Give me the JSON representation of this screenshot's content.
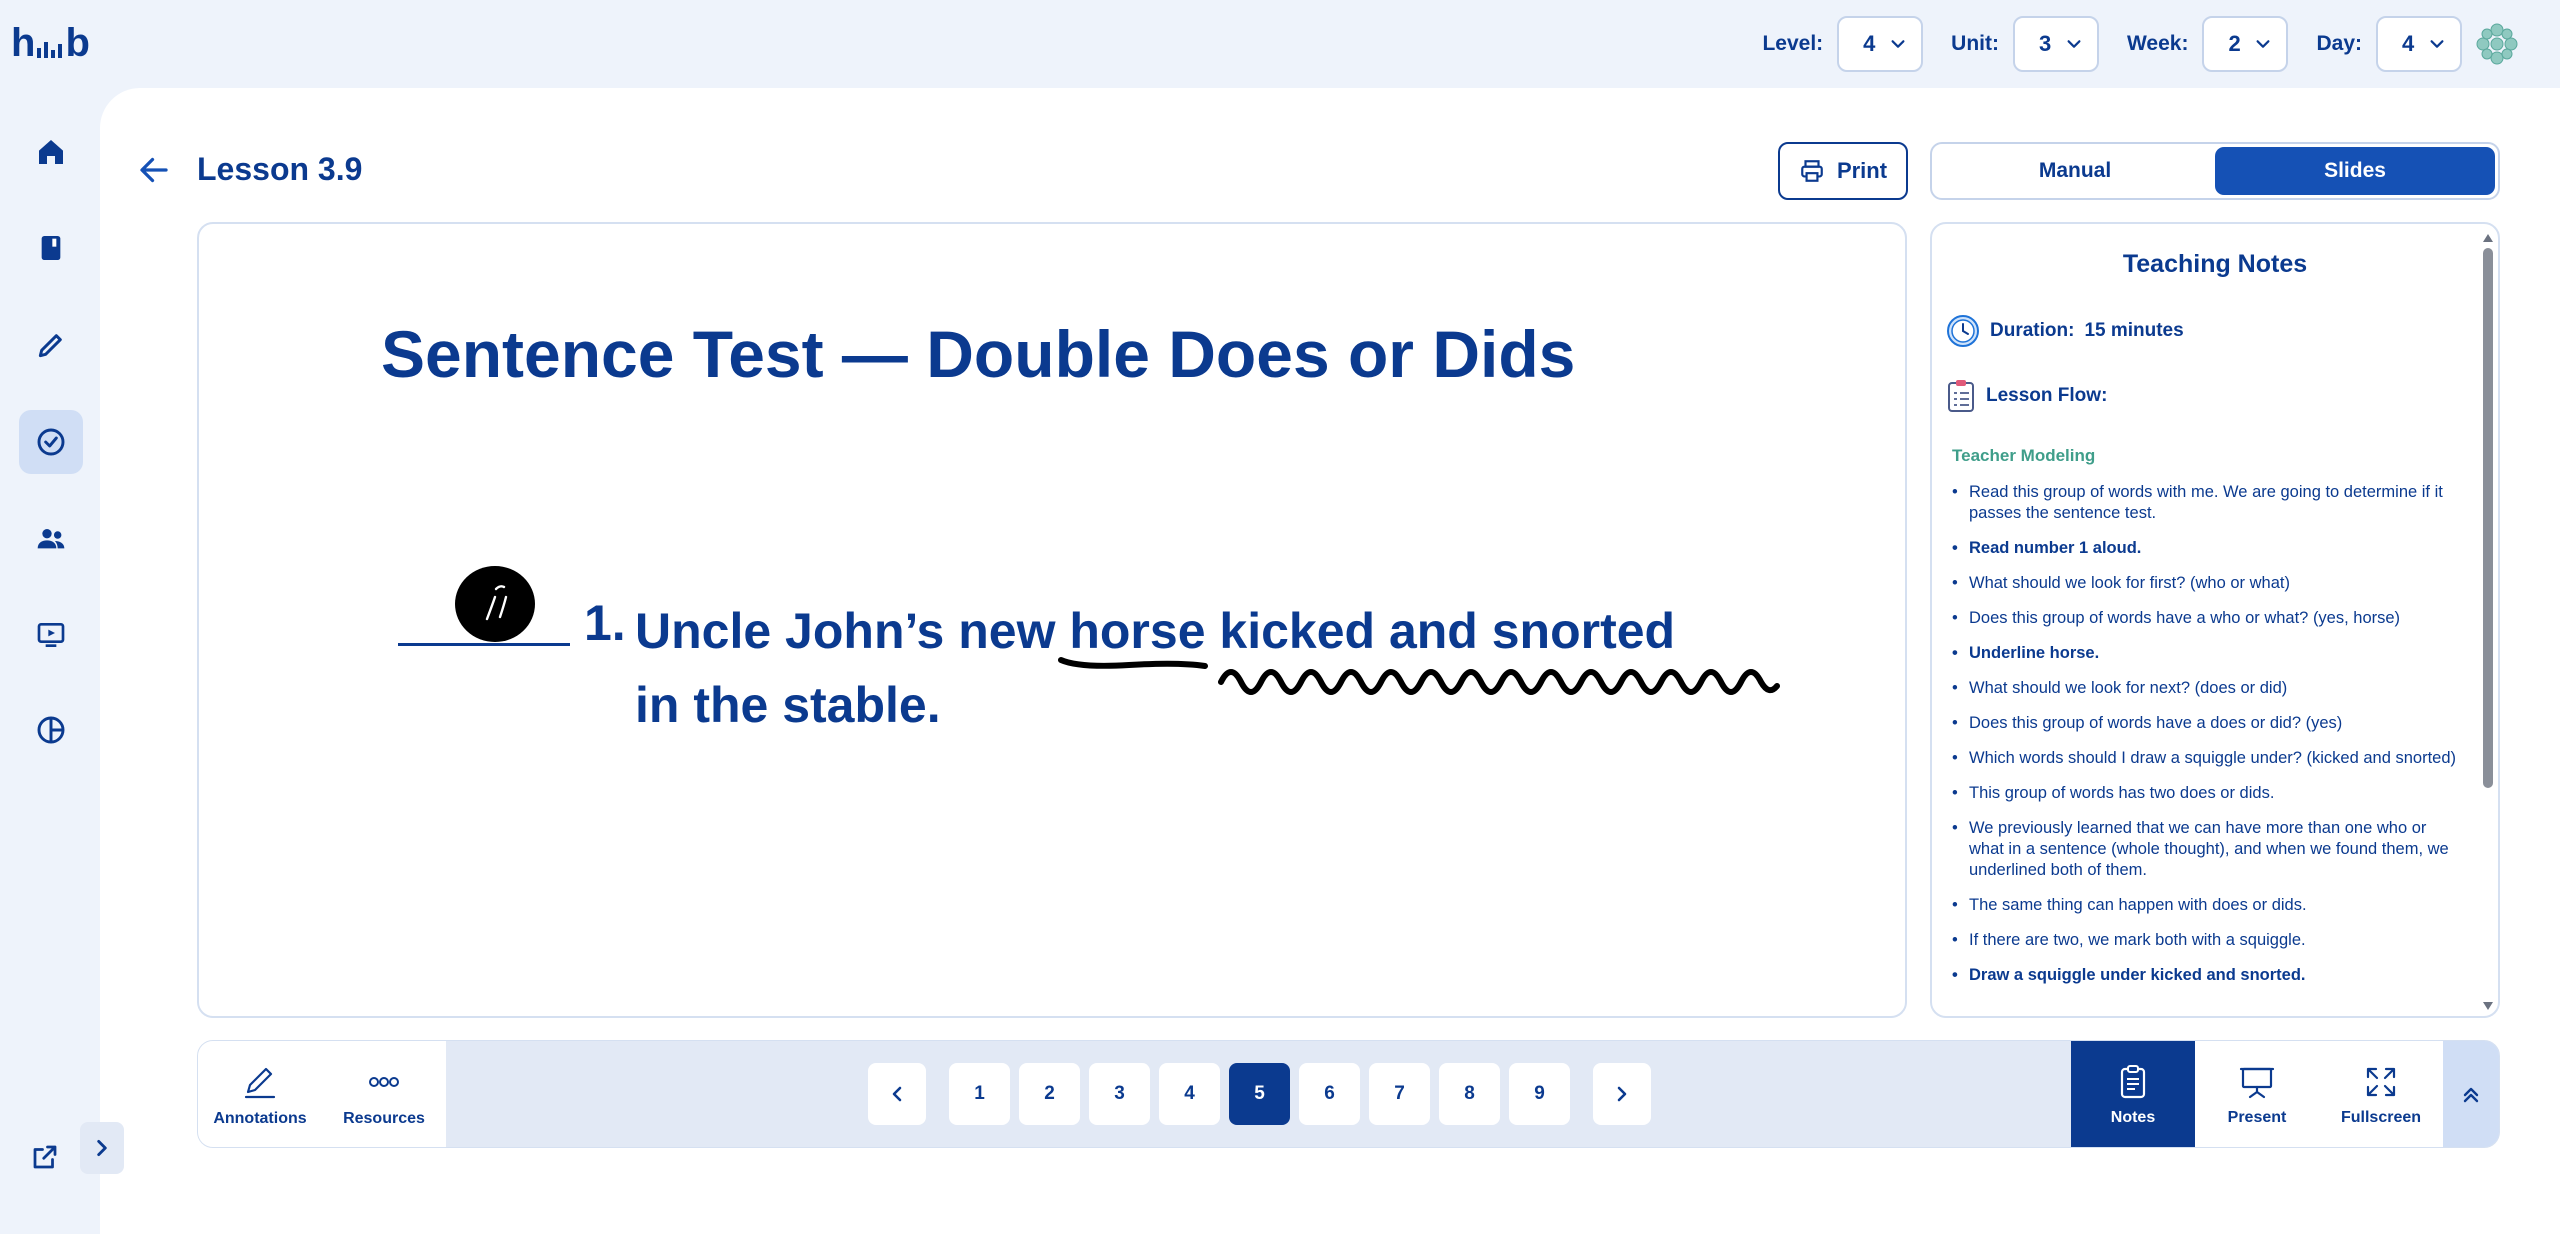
{
  "app": {
    "logo": "hub"
  },
  "topbar": {
    "selectors": [
      {
        "label": "Level:",
        "value": "4"
      },
      {
        "label": "Unit:",
        "value": "3"
      },
      {
        "label": "Week:",
        "value": "2"
      },
      {
        "label": "Day:",
        "value": "4"
      }
    ]
  },
  "sidebar": {
    "items": [
      {
        "icon": "home-icon",
        "active": false
      },
      {
        "icon": "book-icon",
        "active": false
      },
      {
        "icon": "pencil-icon",
        "active": false
      },
      {
        "icon": "check-circle-icon",
        "active": true
      },
      {
        "icon": "users-icon",
        "active": false
      },
      {
        "icon": "presentation-icon",
        "active": false
      },
      {
        "icon": "pie-chart-icon",
        "active": false
      }
    ]
  },
  "header": {
    "title": "Lesson 3.9",
    "print_label": "Print",
    "view_toggle": {
      "manual": "Manual",
      "slides": "Slides",
      "selected": "Slides"
    }
  },
  "slide": {
    "title": "Sentence Test — Double Does or Dids",
    "question_number": "1.",
    "line1": "Uncle John’s new horse kicked and snorted",
    "line2": "in the stable."
  },
  "notes": {
    "title": "Teaching Notes",
    "duration_label": "Duration:",
    "duration_value": "15 minutes",
    "flow_label": "Lesson Flow:",
    "section": "Teacher Modeling",
    "items": [
      "Read this group of words with me. We are going to determine if it passes the sentence test.",
      "Read number 1 aloud.",
      "What should we look for first? (who or what)",
      "Does this group of words have a who or what? (yes, horse)",
      "Underline horse.",
      "What should we look for next? (does or did)",
      "Does this group of words have a does or did? (yes)",
      "Which words should I draw a squiggle under? (kicked and snorted)",
      "This group of words has two does or dids.",
      "We previously learned that we can have more than one who or what in a sentence (whole thought), and when we found them, we underlined both of them.",
      "The same thing can happen with does or dids.",
      "If there are two, we mark both with a squiggle.",
      "Draw a squiggle under kicked and snorted."
    ]
  },
  "bottombar": {
    "annotations": "Annotations",
    "resources": "Resources",
    "pages": [
      "1",
      "2",
      "3",
      "4",
      "5",
      "6",
      "7",
      "8",
      "9"
    ],
    "current_page": "5",
    "notes": "Notes",
    "present": "Present",
    "fullscreen": "Fullscreen"
  },
  "colors": {
    "primary": "#0b3a8f",
    "accent": "#1551b5",
    "section_green": "#3f9e8a",
    "background": "#eef3fb"
  }
}
